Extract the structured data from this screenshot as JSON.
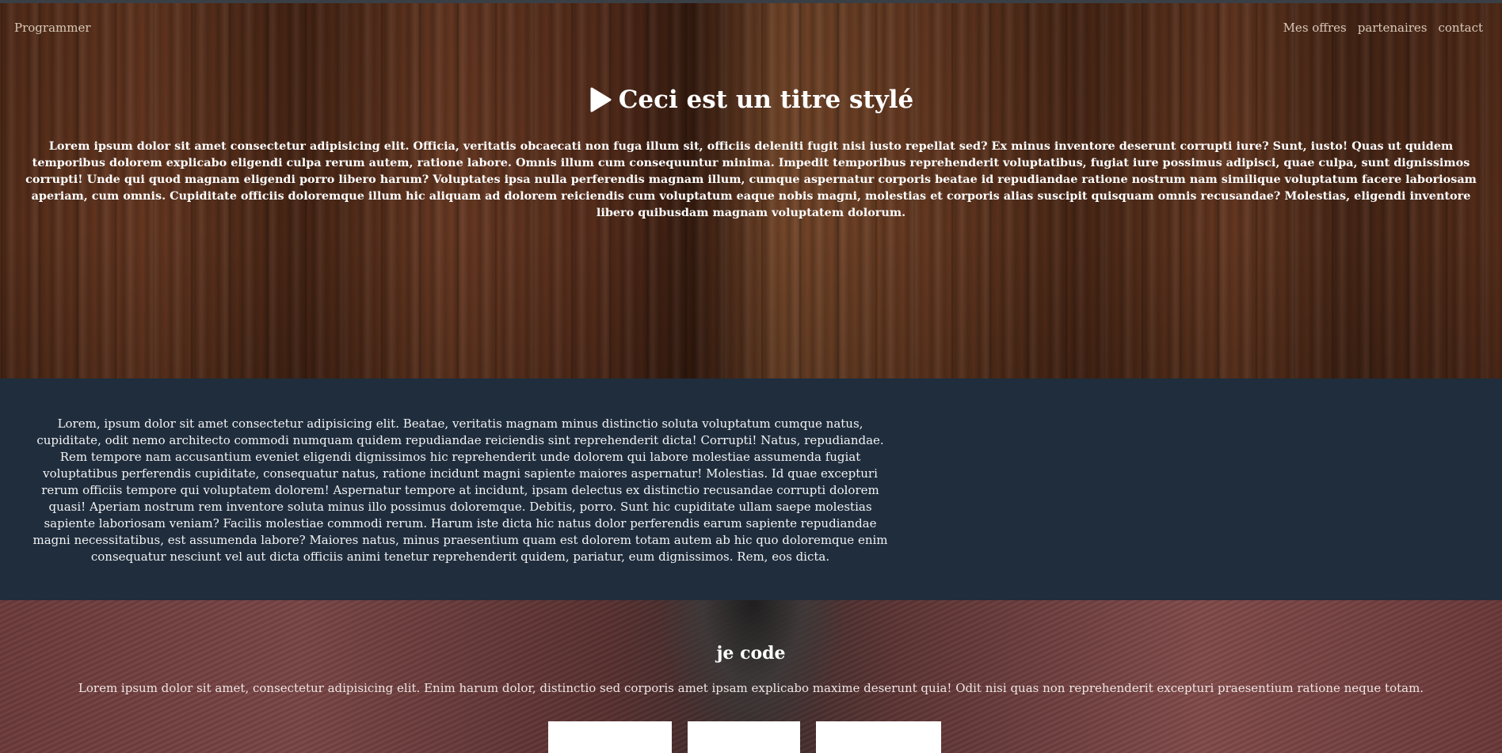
{
  "nav": {
    "brand": "Programmer",
    "links": [
      "Mes offres",
      "partenaires",
      "contact"
    ]
  },
  "hero": {
    "icon": "play-icon",
    "title": "Ceci est un titre stylé",
    "text": "Lorem ipsum dolor sit amet consectetur adipisicing elit. Officia, veritatis obcaecati non fuga illum sit, officiis deleniti fugit nisi iusto repellat sed? Ex minus inventore deserunt corrupti iure? Sunt, iusto! Quas ut quidem temporibus dolorem explicabo eligendi culpa rerum autem, ratione labore. Omnis illum cum consequuntur minima. Impedit temporibus reprehenderit voluptatibus, fugiat iure possimus adipisci, quae culpa, sunt dignissimos corrupti! Unde qui quod magnam eligendi porro libero harum? Voluptates ipsa nulla perferendis magnam illum, cumque aspernatur corporis beatae id repudiandae ratione nostrum nam similique voluptatum facere laboriosam aperiam, cum omnis. Cupiditate officiis doloremque illum hic aliquam ad dolorem reiciendis cum voluptatum eaque nobis magni, molestias et corporis alias suscipit quisquam omnis recusandae? Molestias, eligendi inventore libero quibusdam magnam voluptatem dolorum."
  },
  "dark_section": {
    "text": "Lorem, ipsum dolor sit amet consectetur adipisicing elit. Beatae, veritatis magnam minus distinctio soluta voluptatum cumque natus, cupiditate, odit nemo architecto commodi numquam quidem repudiandae reiciendis sint reprehenderit dicta! Corrupti! Natus, repudiandae. Rem tempore nam accusantium eveniet eligendi dignissimos hic reprehenderit unde dolorem qui labore molestiae assumenda fugiat voluptatibus perferendis cupiditate, consequatur natus, ratione incidunt magni sapiente maiores aspernatur! Molestias. Id quae excepturi rerum officiis tempore qui voluptatem dolorem! Aspernatur tempore at incidunt, ipsam delectus ex distinctio recusandae corrupti dolorem quasi! Aperiam nostrum rem inventore soluta minus illo possimus doloremque. Debitis, porro. Sunt hic cupiditate ullam saepe molestias sapiente laboriosam veniam? Facilis molestiae commodi rerum. Harum iste dicta hic natus dolor perferendis earum sapiente repudiandae magni necessitatibus, est assumenda labore? Maiores natus, minus praesentium quam est dolorem totam autem ab hic quo doloremque enim consequatur nesciunt vel aut dicta officiis animi tenetur reprehenderit quidem, pariatur, eum dignissimos. Rem, eos dicta."
  },
  "book_section": {
    "title": "je code",
    "text": "Lorem ipsum dolor sit amet, consectetur adipisicing elit. Enim harum dolor, distinctio sed corporis amet ipsam explicabo maxime deserunt quia! Odit nisi quas non reprehenderit excepturi praesentium ratione neque totam."
  },
  "colors": {
    "dark_section_bg": "#1f2d3d",
    "nav_text": "#d9c9b8",
    "card_bg": "#ffffff"
  }
}
